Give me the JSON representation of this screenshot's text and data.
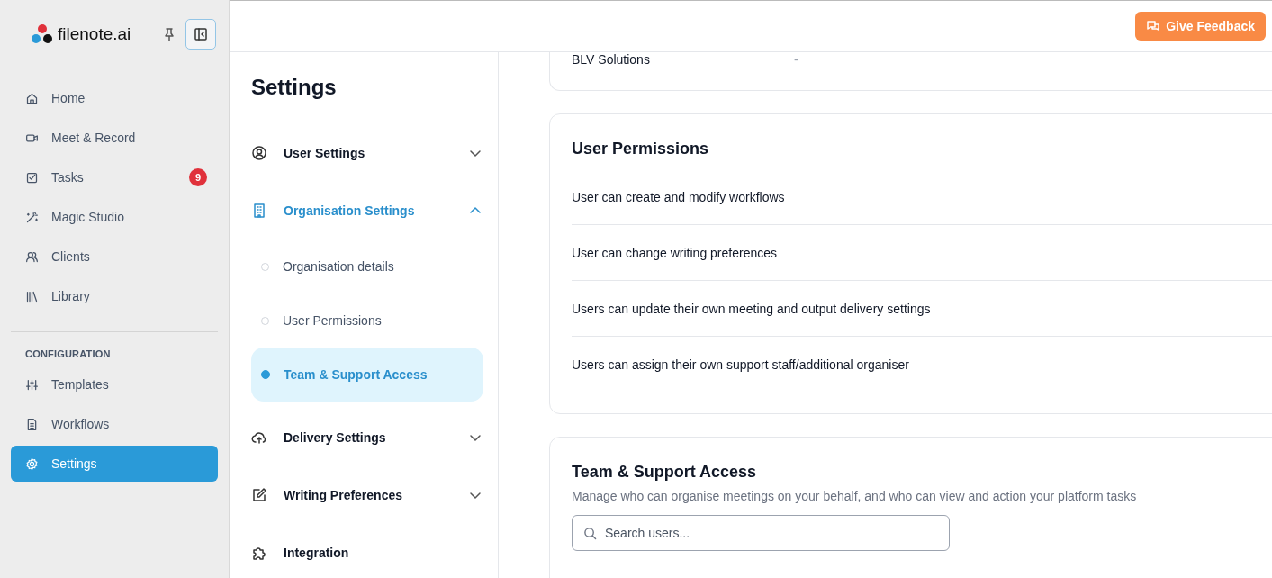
{
  "sidebar": {
    "logo": "filenote.ai",
    "nav_items": [
      {
        "label": "Home",
        "selected": false
      },
      {
        "label": "Meet & Record",
        "selected": false
      },
      {
        "label": "Tasks",
        "badge": "9",
        "selected": false
      },
      {
        "label": "Magic Studio",
        "selected": false
      },
      {
        "label": "Clients",
        "selected": false
      },
      {
        "label": "Library",
        "selected": false
      }
    ],
    "section_label": "CONFIGURATION",
    "config_items": [
      {
        "label": "Templates",
        "selected": false
      },
      {
        "label": "Workflows",
        "selected": false
      },
      {
        "label": "Settings",
        "selected": true
      }
    ]
  },
  "top_bar": {
    "feedback_button": "Give Feedback"
  },
  "settings_nav": {
    "title": "Settings",
    "sections": [
      {
        "label": "User Settings",
        "kind": "group",
        "expanded": false,
        "selected": false
      },
      {
        "label": "Organisation Settings",
        "kind": "group",
        "expanded": true,
        "selected": true,
        "children": [
          {
            "label": "Organisation details",
            "selected": false
          },
          {
            "label": "User Permissions",
            "selected": false
          },
          {
            "label": "Team & Support Access",
            "selected": true
          }
        ]
      },
      {
        "label": "Delivery Settings",
        "kind": "group",
        "expanded": false,
        "selected": false
      },
      {
        "label": "Writing Preferences",
        "kind": "group",
        "expanded": false,
        "selected": false
      },
      {
        "label": "Integration",
        "kind": "link",
        "selected": false
      }
    ]
  },
  "organisation_card": {
    "label": "BLV Solutions",
    "value": "-"
  },
  "permissions_card": {
    "title": "User Permissions",
    "rows": [
      "User can create and modify workflows",
      "User can change writing preferences",
      "Users can update their own meeting and output delivery settings",
      "Users can assign their own support staff/additional organiser"
    ]
  },
  "team_card": {
    "title": "Team & Support Access",
    "description": "Manage who can organise meetings on your behalf, and who can view and action your platform tasks",
    "search": {
      "placeholder": "Search users..."
    }
  }
}
